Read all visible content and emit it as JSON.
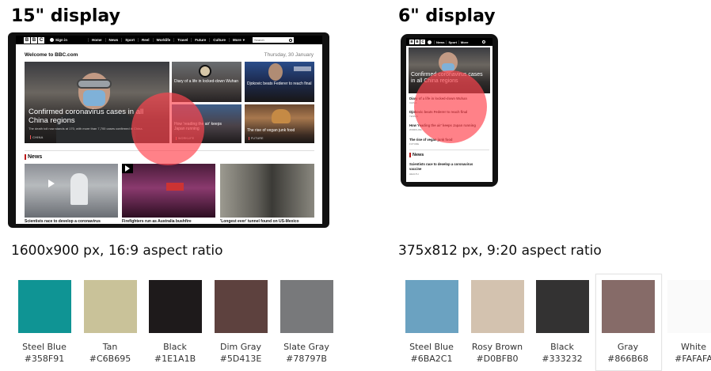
{
  "left": {
    "heading": "15\" display",
    "resolution": "1600x900 px, 16:9 aspect ratio",
    "nav": {
      "logo": [
        "B",
        "B",
        "C"
      ],
      "signin": "Sign in",
      "items": [
        "Home",
        "News",
        "Sport",
        "Reel",
        "Worklife",
        "Travel",
        "Future",
        "Culture",
        "More"
      ],
      "more_arrow": "▾",
      "search_placeholder": "Search"
    },
    "welcome": "Welcome to BBC.com",
    "date": "Thursday, 30 January",
    "hero": {
      "title": "Confirmed coronavirus cases in all China regions",
      "summary": "The death toll now stands at 170, with more than 7,700 cases confirmed in China.",
      "tag": "CHINA"
    },
    "cards": [
      {
        "title": "Diary of a life in locked-down Wuhan",
        "tag": ""
      },
      {
        "title": "Djokovic beats Federer to reach final",
        "tag": ""
      },
      {
        "title": "How 'reading the air' keeps Japan running",
        "tag": "WORKLIFE"
      },
      {
        "title": "The rise of vegan junk food",
        "tag": "FUTURE"
      }
    ],
    "news_heading": "News",
    "news_cards": [
      {
        "title": "Scientists race to develop a coronavirus"
      },
      {
        "title": "Firefighters run as Australia bushfire"
      },
      {
        "title": "'Longest ever' tunnel found on US-Mexico"
      }
    ],
    "swatches": [
      {
        "name": "Steel Blue",
        "hex": "#358F91",
        "color": "#0F9494"
      },
      {
        "name": "Tan",
        "hex": "#C6B695",
        "color": "#C9C299"
      },
      {
        "name": "Black",
        "hex": "#1E1A1B",
        "color": "#1E1A1B"
      },
      {
        "name": "Dim Gray",
        "hex": "#5D413E",
        "color": "#5D413E"
      },
      {
        "name": "Slate Gray",
        "hex": "#78797B",
        "color": "#78797B"
      }
    ]
  },
  "right": {
    "heading": "6\" display",
    "resolution": "375x812 px, 9:20 aspect ratio",
    "nav": {
      "logo": [
        "B",
        "B",
        "C"
      ],
      "items": [
        "News",
        "Sport",
        "More"
      ]
    },
    "hero_title": "Confirmed coronavirus cases in all China regions",
    "list": [
      {
        "title": "Diary of a life in locked-down Wuhan",
        "tag": "CHINA"
      },
      {
        "title": "Djokovic beats Federer to reach final",
        "tag": "TENNIS"
      },
      {
        "title": "How 'reading the air' keeps Japan running",
        "tag": "WORKLIFE"
      },
      {
        "title": "The rise of vegan junk food",
        "tag": "FUTURE"
      }
    ],
    "news_heading": "News",
    "news_item": {
      "title": "Scientists race to develop a coronavirus vaccine",
      "tag": "HEALTH"
    },
    "swatches": [
      {
        "name": "Steel Blue",
        "hex": "#6BA2C1",
        "color": "#6BA2C1"
      },
      {
        "name": "Rosy Brown",
        "hex": "#D0BFB0",
        "color": "#D3C2AF"
      },
      {
        "name": "Black",
        "hex": "#333232",
        "color": "#333232"
      },
      {
        "name": "Gray",
        "hex": "#866B68",
        "color": "#866B68"
      },
      {
        "name": "White",
        "hex": "#FAFAFA",
        "color": "#FAFAFA"
      }
    ]
  }
}
